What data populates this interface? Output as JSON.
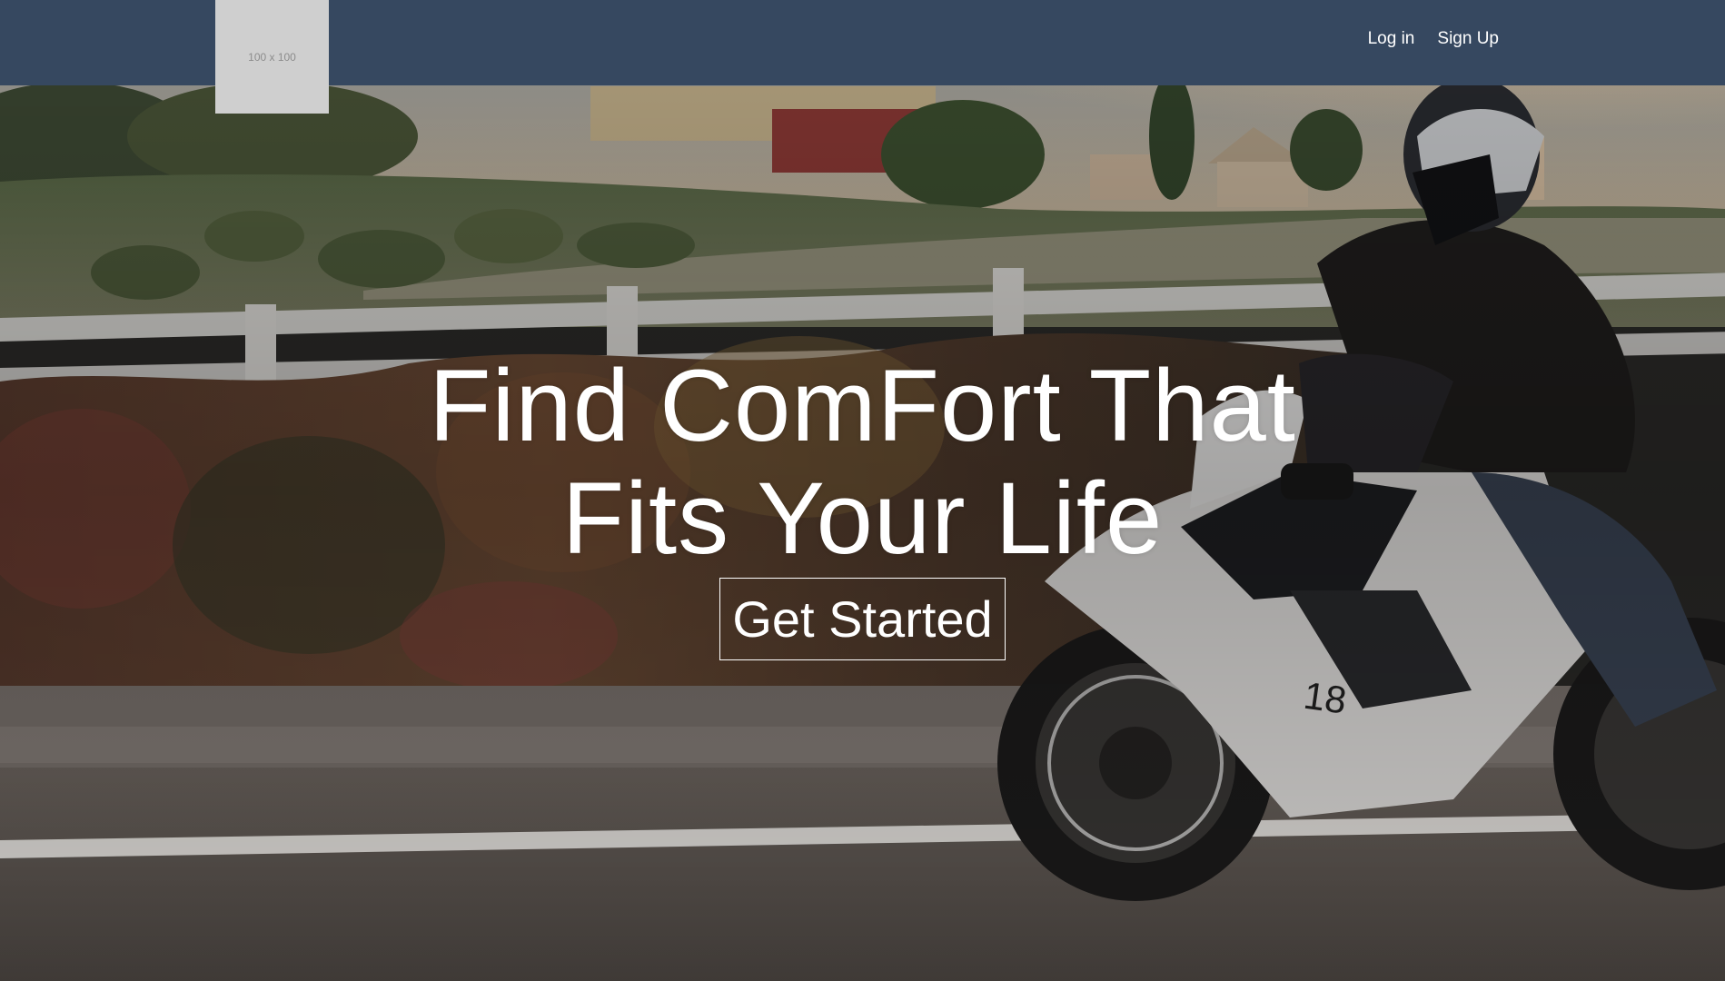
{
  "navbar": {
    "logo_placeholder_text": "100 x 100",
    "links": [
      {
        "label": "Log in"
      },
      {
        "label": "Sign Up"
      }
    ]
  },
  "hero": {
    "headline_line1": "Find ComFort That",
    "headline_line2": "Fits Your Life",
    "cta_label": "Get Started",
    "background": "motorcycle-rider-photo",
    "bike_number": "18"
  },
  "colors": {
    "navbar": "#364860",
    "logo_placeholder": "#cfcfcf",
    "text": "#ffffff"
  }
}
